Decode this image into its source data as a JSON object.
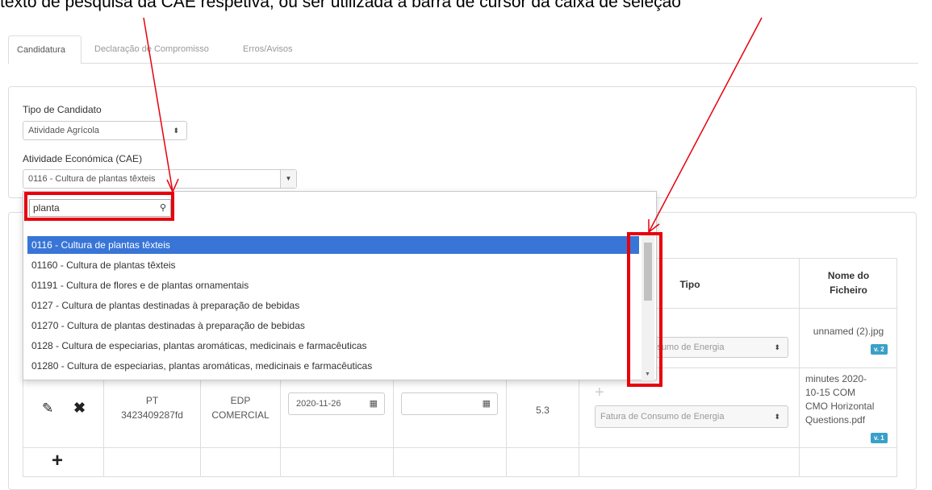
{
  "caption_text": "texto de pesquisa da CAE respetiva, ou ser utilizada a barra de cursor da caixa de seleção",
  "tabs": [
    {
      "label": "Candidatura",
      "active": true
    },
    {
      "label": "Declaração de Compromisso",
      "active": false
    },
    {
      "label": "Erros/Avisos",
      "active": false
    }
  ],
  "form": {
    "tipo_label": "Tipo de Candidato",
    "tipo_value": "Atividade Agrícola",
    "cae_label": "Atividade Económica (CAE)",
    "cae_value": "0116 - Cultura de plantas têxteis"
  },
  "dropdown": {
    "search_value": "planta",
    "options": [
      "0116 - Cultura de plantas têxteis",
      "01160 - Cultura de plantas têxteis",
      "01191 - Cultura de flores e de plantas ornamentais",
      "0127 - Cultura de plantas destinadas à preparação de bebidas",
      "01270 - Cultura de plantas destinadas à preparação de bebidas",
      "0128 - Cultura de especiarias, plantas aromáticas, medicinais e farmacêuticas",
      "01280 - Cultura de especiarias, plantas aromáticas, medicinais e farmacêuticas"
    ],
    "highlighted_index": 0
  },
  "table": {
    "headers": {
      "tipo": "Tipo",
      "nome_line1": "Nome do",
      "nome_line2": "Ficheiro"
    },
    "row1": {
      "tipo_select": "Fatura de Consumo de Energia",
      "file_name": "unnamed (2).jpg",
      "version": "v. 2"
    },
    "row2": {
      "nif_line1": "PT",
      "nif_line2": "3423409287fd",
      "company_line1": "EDP",
      "company_line2": "COMERCIAL",
      "date_start": "2020-11-26",
      "date_end": "",
      "value": "5.3",
      "tipo_select": "Fatura de Consumo de Energia",
      "file_line1": "minutes 2020-",
      "file_line2": "10-15 COM",
      "file_line3": "CMO Horizontal",
      "file_line4": "Questions.pdf",
      "version": "v. 1"
    }
  },
  "colors": {
    "highlight": "#3875d7",
    "annotation": "#e8000d",
    "badge": "#3aa0c8"
  }
}
